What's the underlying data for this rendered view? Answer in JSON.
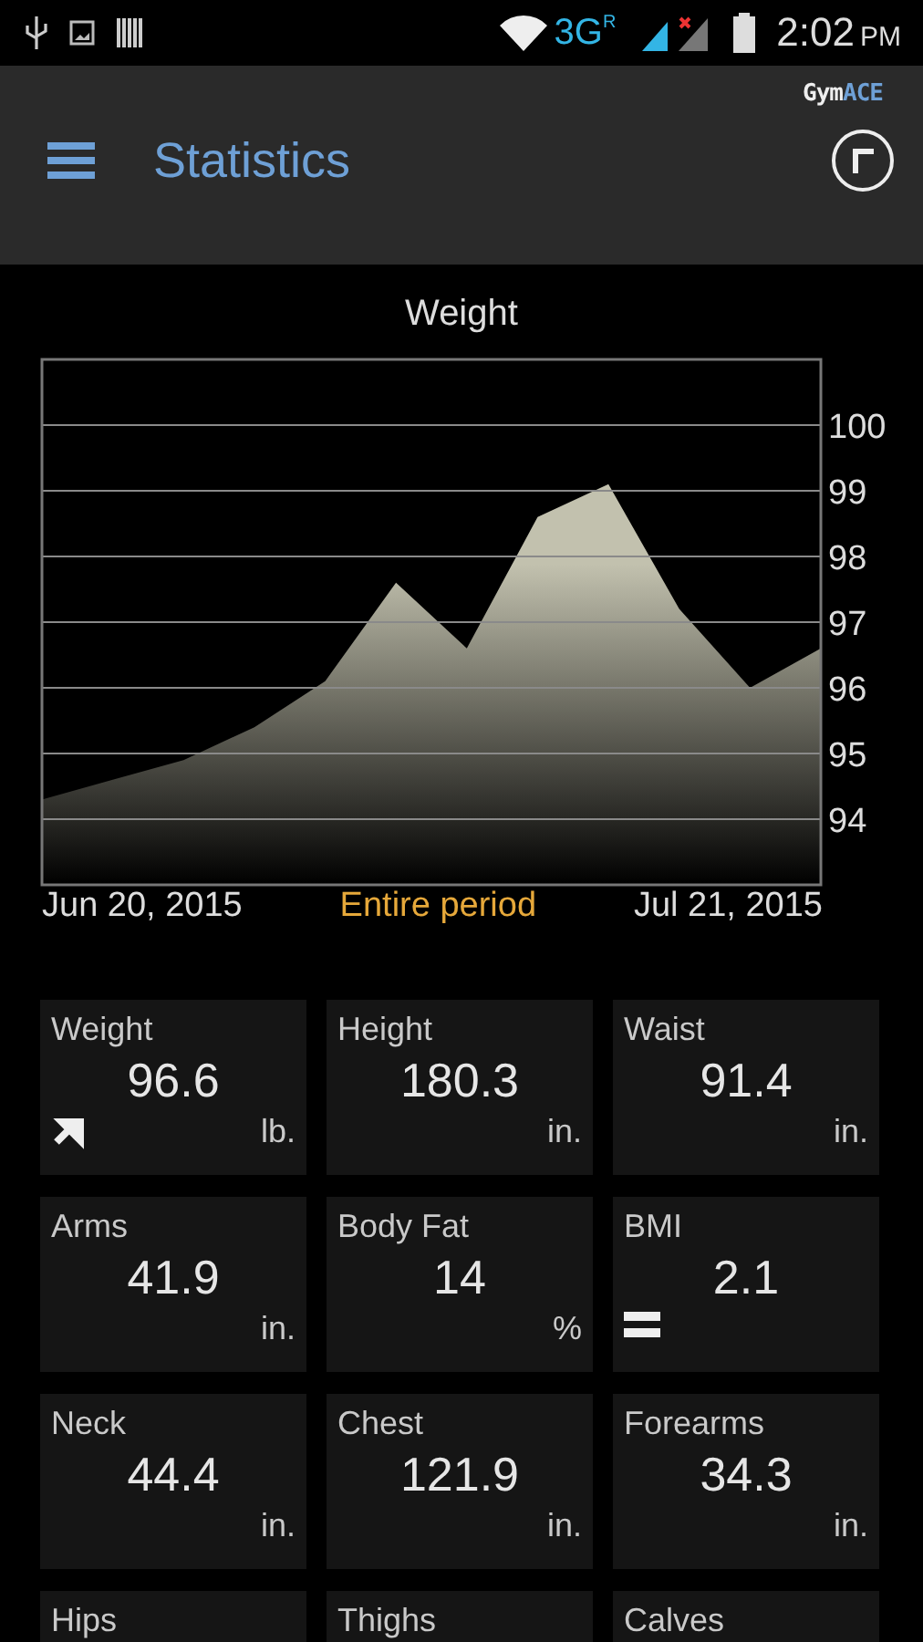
{
  "status_bar": {
    "network": "3G",
    "roaming": "R",
    "time": "2:02",
    "ampm": "PM"
  },
  "app_bar": {
    "logo_left": "Gym",
    "logo_right": "ACE",
    "title": "Statistics"
  },
  "chart": {
    "start_label": "Jun 20, 2015",
    "period": "Entire period",
    "end_label": "Jul 21, 2015",
    "chart_data": {
      "type": "area",
      "title": "Weight",
      "categories": [
        null,
        null,
        null,
        null,
        null,
        null,
        null,
        null,
        null,
        null,
        null,
        null
      ],
      "series": [
        {
          "color": "#c2c1ae",
          "values": [
            94.3,
            94.6,
            94.9,
            95.4,
            96.1,
            97.6,
            96.6,
            98.6,
            99.1,
            97.2,
            96.0,
            96.6
          ]
        }
      ],
      "ylim": [
        93,
        101
      ],
      "grid": true,
      "yticks": [
        {
          "value": 94,
          "label": "94"
        },
        {
          "value": 95,
          "label": "95"
        },
        {
          "value": 96,
          "label": "96"
        },
        {
          "value": 97,
          "label": "97"
        },
        {
          "value": 98,
          "label": "98"
        },
        {
          "value": 99,
          "label": "99"
        },
        {
          "value": 100,
          "label": "100"
        }
      ]
    }
  },
  "tiles": [
    {
      "kind": "rising",
      "label": "Weight",
      "value": "96.6",
      "unit": "lb."
    },
    {
      "kind": "plain",
      "label": "Height",
      "value": "180.3",
      "unit": "in."
    },
    {
      "kind": "plain",
      "label": "Waist",
      "value": "91.4",
      "unit": "in."
    },
    {
      "kind": "plain",
      "label": "Arms",
      "value": "41.9",
      "unit": "in."
    },
    {
      "kind": "plain",
      "label": "Body Fat",
      "value": "14",
      "unit": "%"
    },
    {
      "kind": "steady",
      "label": "BMI",
      "value": "2.1"
    },
    {
      "kind": "plain",
      "label": "Neck",
      "value": "44.4",
      "unit": "in."
    },
    {
      "kind": "plain",
      "label": "Chest",
      "value": "121.9",
      "unit": "in."
    },
    {
      "kind": "plain",
      "label": "Forearms",
      "value": "34.3",
      "unit": "in."
    },
    {
      "kind": "plain",
      "label": "Hips"
    },
    {
      "kind": "plain",
      "label": "Thighs"
    },
    {
      "kind": "plain",
      "label": "Calves"
    }
  ]
}
